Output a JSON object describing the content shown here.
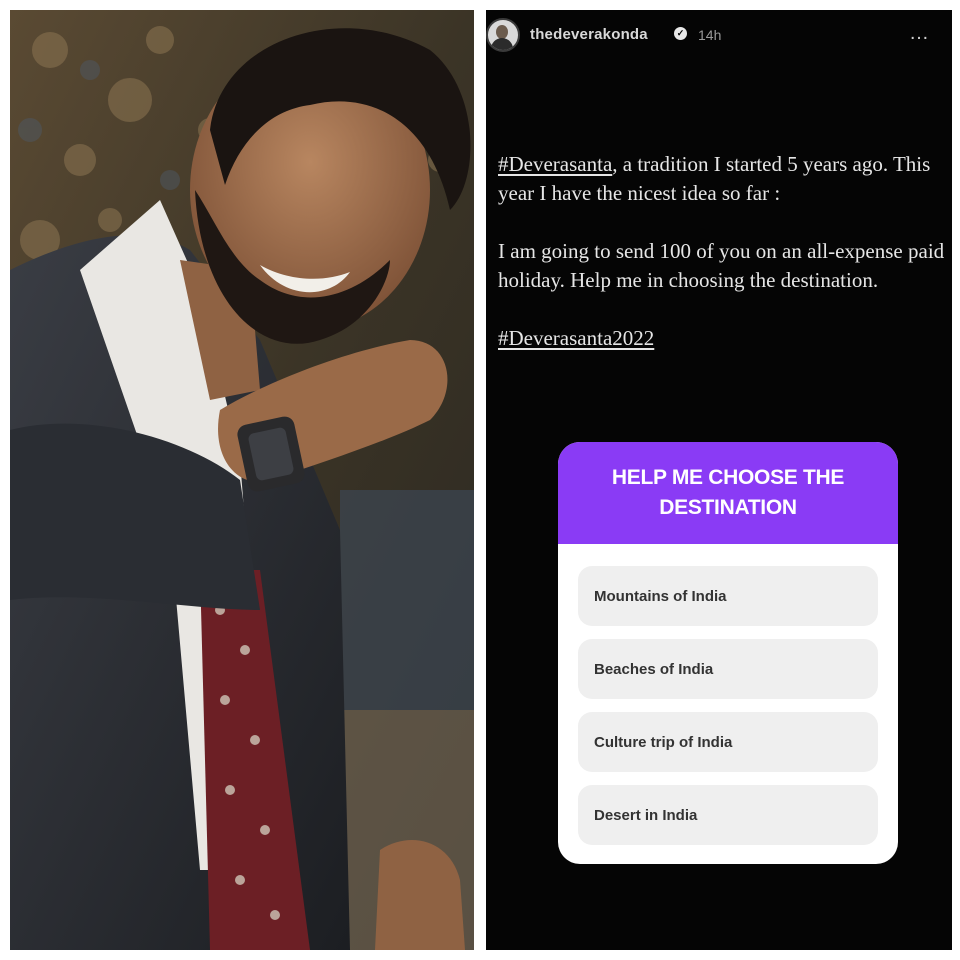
{
  "story": {
    "username": "thedeverakonda",
    "verified_icon": "verified-badge-icon",
    "time": "14h",
    "more_icon": "more-options-icon",
    "more_glyph": "…",
    "paragraph1_hashtag": "#Deverasanta",
    "paragraph1_text": ", a tradition I started 5 years ago. This year I have the nicest idea so far :",
    "paragraph2_text": "I am going to send 100 of you on an all-expense paid holiday. Help me in choosing the destination.",
    "hashtag2": "#Deverasanta2022"
  },
  "poll": {
    "question": "HELP ME CHOOSE THE DESTINATION",
    "header_color": "#8a3bf5",
    "options": [
      {
        "label": "Mountains of India"
      },
      {
        "label": "Beaches of India"
      },
      {
        "label": "Culture trip of India"
      },
      {
        "label": "Desert in India"
      }
    ]
  },
  "colors": {
    "story_background": "#050505",
    "poll_option_background": "#efefef"
  }
}
